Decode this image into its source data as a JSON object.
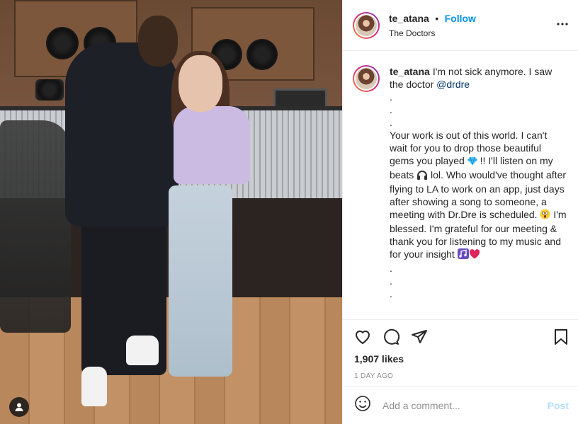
{
  "post": {
    "username": "te_atana",
    "follow_label": "Follow",
    "dot": "•",
    "location": "The Doctors",
    "more_icon": "more-horizontal-icon"
  },
  "caption": {
    "username": "te_atana",
    "line1": "I'm not sick anymore. I saw the doctor ",
    "mention": "@drdre",
    "dots_top": [
      ".",
      ".",
      "."
    ],
    "body_1": "Your work is out of this world. I can't wait for you to drop those beautiful gems you played ",
    "body_2": " !! I'll listen on my beats ",
    "body_3": " lol. Who would've thought after flying to LA to work on an app, just days after showing a song to someone, a meeting with Dr.Dre is scheduled. ",
    "body_4": " I'm blessed. I'm grateful for our meeting & thank you for listening to my music and for your insight ",
    "dots_bottom": [
      ".",
      ".",
      "."
    ],
    "emoji": {
      "gem": "gem-emoji-icon",
      "headphones": "headphones-emoji-icon",
      "astonished": "astonished-face-emoji-icon",
      "notes": "musical-notes-emoji-icon",
      "heart": "red-heart-emoji-icon"
    }
  },
  "actions": {
    "likes": "1,907 likes",
    "time": "1 DAY AGO"
  },
  "comment": {
    "placeholder": "Add a comment...",
    "post_label": "Post"
  },
  "colors": {
    "follow": "#0095f6",
    "mention": "#00376b",
    "post_disabled": "#b2dffc",
    "muted": "#8e8e8e",
    "heart": "#e0245e"
  }
}
